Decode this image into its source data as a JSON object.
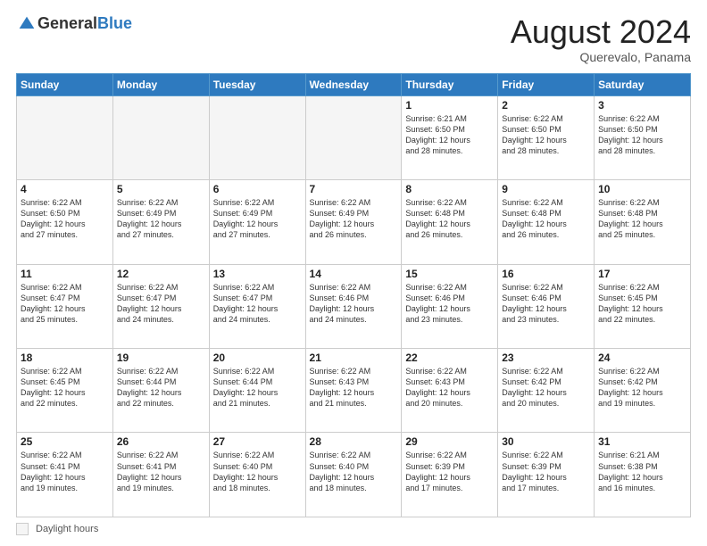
{
  "logo": {
    "general": "General",
    "blue": "Blue"
  },
  "header": {
    "month_year": "August 2024",
    "location": "Querevalo, Panama"
  },
  "weekdays": [
    "Sunday",
    "Monday",
    "Tuesday",
    "Wednesday",
    "Thursday",
    "Friday",
    "Saturday"
  ],
  "footer": {
    "daylight_label": "Daylight hours"
  },
  "weeks": [
    [
      {
        "day": "",
        "info": ""
      },
      {
        "day": "",
        "info": ""
      },
      {
        "day": "",
        "info": ""
      },
      {
        "day": "",
        "info": ""
      },
      {
        "day": "1",
        "info": "Sunrise: 6:21 AM\nSunset: 6:50 PM\nDaylight: 12 hours\nand 28 minutes."
      },
      {
        "day": "2",
        "info": "Sunrise: 6:22 AM\nSunset: 6:50 PM\nDaylight: 12 hours\nand 28 minutes."
      },
      {
        "day": "3",
        "info": "Sunrise: 6:22 AM\nSunset: 6:50 PM\nDaylight: 12 hours\nand 28 minutes."
      }
    ],
    [
      {
        "day": "4",
        "info": "Sunrise: 6:22 AM\nSunset: 6:50 PM\nDaylight: 12 hours\nand 27 minutes."
      },
      {
        "day": "5",
        "info": "Sunrise: 6:22 AM\nSunset: 6:49 PM\nDaylight: 12 hours\nand 27 minutes."
      },
      {
        "day": "6",
        "info": "Sunrise: 6:22 AM\nSunset: 6:49 PM\nDaylight: 12 hours\nand 27 minutes."
      },
      {
        "day": "7",
        "info": "Sunrise: 6:22 AM\nSunset: 6:49 PM\nDaylight: 12 hours\nand 26 minutes."
      },
      {
        "day": "8",
        "info": "Sunrise: 6:22 AM\nSunset: 6:48 PM\nDaylight: 12 hours\nand 26 minutes."
      },
      {
        "day": "9",
        "info": "Sunrise: 6:22 AM\nSunset: 6:48 PM\nDaylight: 12 hours\nand 26 minutes."
      },
      {
        "day": "10",
        "info": "Sunrise: 6:22 AM\nSunset: 6:48 PM\nDaylight: 12 hours\nand 25 minutes."
      }
    ],
    [
      {
        "day": "11",
        "info": "Sunrise: 6:22 AM\nSunset: 6:47 PM\nDaylight: 12 hours\nand 25 minutes."
      },
      {
        "day": "12",
        "info": "Sunrise: 6:22 AM\nSunset: 6:47 PM\nDaylight: 12 hours\nand 24 minutes."
      },
      {
        "day": "13",
        "info": "Sunrise: 6:22 AM\nSunset: 6:47 PM\nDaylight: 12 hours\nand 24 minutes."
      },
      {
        "day": "14",
        "info": "Sunrise: 6:22 AM\nSunset: 6:46 PM\nDaylight: 12 hours\nand 24 minutes."
      },
      {
        "day": "15",
        "info": "Sunrise: 6:22 AM\nSunset: 6:46 PM\nDaylight: 12 hours\nand 23 minutes."
      },
      {
        "day": "16",
        "info": "Sunrise: 6:22 AM\nSunset: 6:46 PM\nDaylight: 12 hours\nand 23 minutes."
      },
      {
        "day": "17",
        "info": "Sunrise: 6:22 AM\nSunset: 6:45 PM\nDaylight: 12 hours\nand 22 minutes."
      }
    ],
    [
      {
        "day": "18",
        "info": "Sunrise: 6:22 AM\nSunset: 6:45 PM\nDaylight: 12 hours\nand 22 minutes."
      },
      {
        "day": "19",
        "info": "Sunrise: 6:22 AM\nSunset: 6:44 PM\nDaylight: 12 hours\nand 22 minutes."
      },
      {
        "day": "20",
        "info": "Sunrise: 6:22 AM\nSunset: 6:44 PM\nDaylight: 12 hours\nand 21 minutes."
      },
      {
        "day": "21",
        "info": "Sunrise: 6:22 AM\nSunset: 6:43 PM\nDaylight: 12 hours\nand 21 minutes."
      },
      {
        "day": "22",
        "info": "Sunrise: 6:22 AM\nSunset: 6:43 PM\nDaylight: 12 hours\nand 20 minutes."
      },
      {
        "day": "23",
        "info": "Sunrise: 6:22 AM\nSunset: 6:42 PM\nDaylight: 12 hours\nand 20 minutes."
      },
      {
        "day": "24",
        "info": "Sunrise: 6:22 AM\nSunset: 6:42 PM\nDaylight: 12 hours\nand 19 minutes."
      }
    ],
    [
      {
        "day": "25",
        "info": "Sunrise: 6:22 AM\nSunset: 6:41 PM\nDaylight: 12 hours\nand 19 minutes."
      },
      {
        "day": "26",
        "info": "Sunrise: 6:22 AM\nSunset: 6:41 PM\nDaylight: 12 hours\nand 19 minutes."
      },
      {
        "day": "27",
        "info": "Sunrise: 6:22 AM\nSunset: 6:40 PM\nDaylight: 12 hours\nand 18 minutes."
      },
      {
        "day": "28",
        "info": "Sunrise: 6:22 AM\nSunset: 6:40 PM\nDaylight: 12 hours\nand 18 minutes."
      },
      {
        "day": "29",
        "info": "Sunrise: 6:22 AM\nSunset: 6:39 PM\nDaylight: 12 hours\nand 17 minutes."
      },
      {
        "day": "30",
        "info": "Sunrise: 6:22 AM\nSunset: 6:39 PM\nDaylight: 12 hours\nand 17 minutes."
      },
      {
        "day": "31",
        "info": "Sunrise: 6:21 AM\nSunset: 6:38 PM\nDaylight: 12 hours\nand 16 minutes."
      }
    ]
  ]
}
